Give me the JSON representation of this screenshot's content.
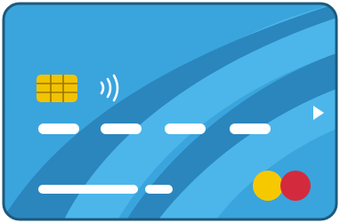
{
  "card": {
    "colors": {
      "base": "#3aa4dd",
      "dark_swoosh": "#2a86bd",
      "light_swoosh": "#4cb6ea",
      "border": "#1d5a7c",
      "chip": "#f2c300",
      "chip_line": "#9a7600",
      "bars": "#ffffff",
      "logo_left": "#f6c800",
      "logo_right": "#d42a3e"
    },
    "icons": {
      "chip": "emv-chip-icon",
      "contactless": "contactless-icon",
      "arrow": "play-arrow-icon",
      "logo": "card-network-logo-icon"
    },
    "number_segments": 4,
    "name_segments": 2
  }
}
